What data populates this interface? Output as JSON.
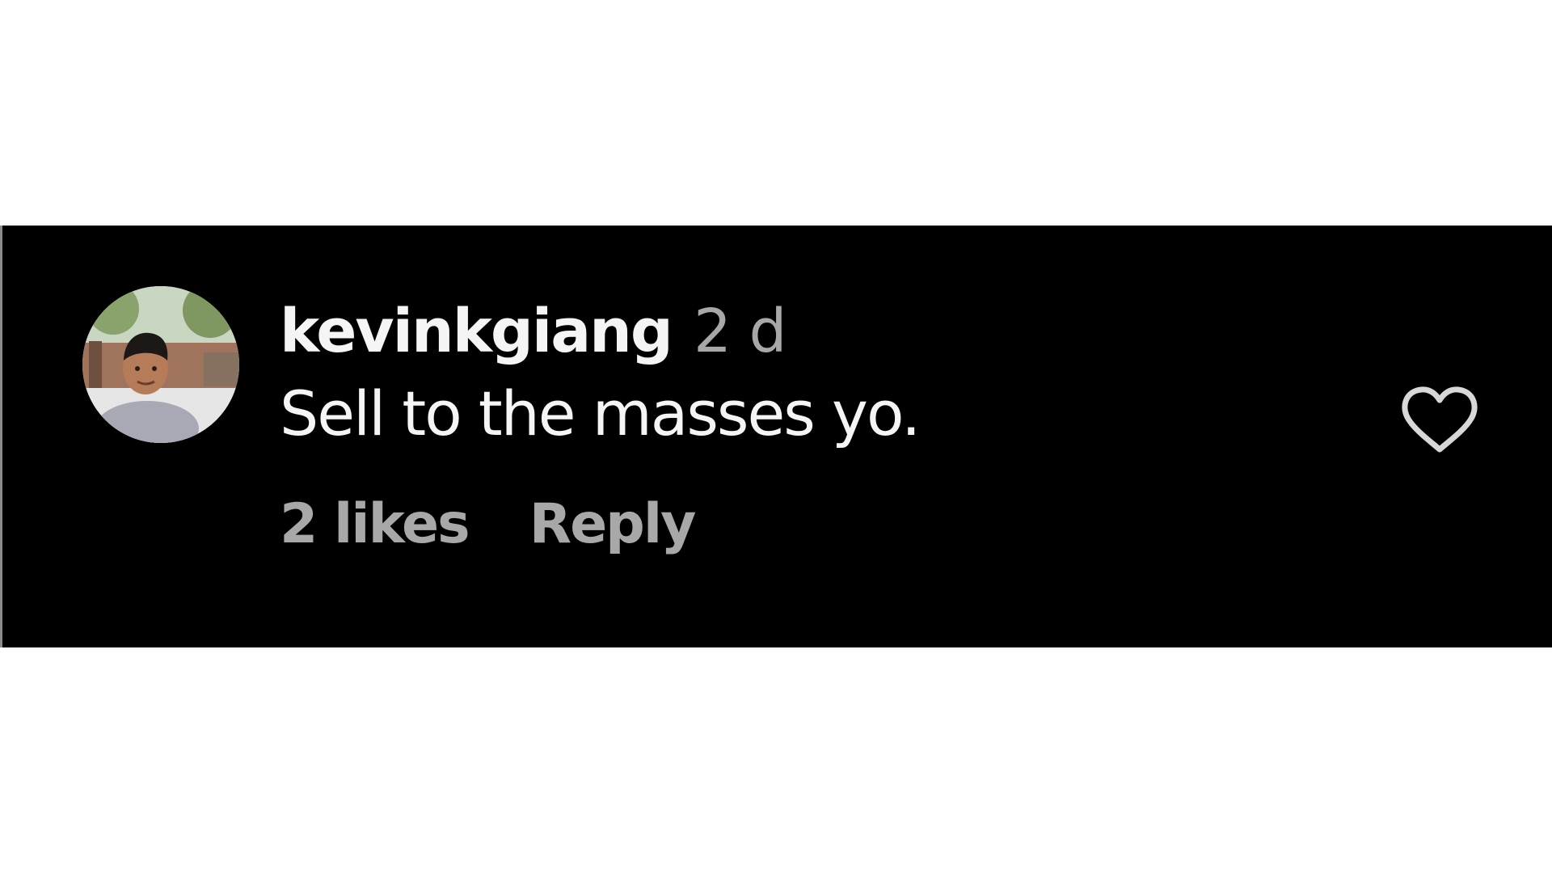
{
  "comment": {
    "username": "kevinkgiang",
    "timestamp": "2 d",
    "text": "Sell to the masses yo.",
    "likes": "2 likes",
    "reply_label": "Reply",
    "like_icon": "heart-outline-icon",
    "avatar_icon": "user-avatar-photo"
  },
  "colors": {
    "background": "#000000",
    "page_background": "#ffffff",
    "primary_text": "#f5f5f5",
    "secondary_text": "#a8a8a8"
  }
}
